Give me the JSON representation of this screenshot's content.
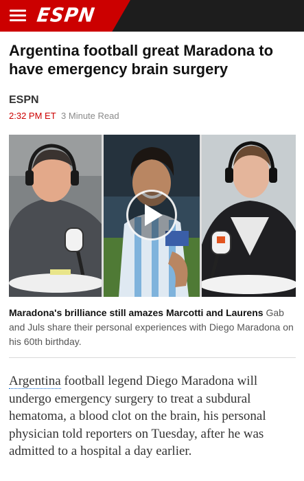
{
  "header": {
    "logo_text": "ESPN",
    "brand_color": "#cc0000",
    "bar_color": "#1d1d1d"
  },
  "article": {
    "headline": "Argentina football great Maradona to have emergency brain surgery",
    "source": "ESPN",
    "time": "2:32 PM ET",
    "read_time": "3 Minute Read"
  },
  "video": {
    "caption_title": "Maradona's brilliance still amazes Marcotti and Laurens",
    "caption_text": "Gab and Juls share their personal experiences with Diego Maradona on his 60th birthday."
  },
  "body": {
    "link_text": "Argentina",
    "rest_text": " football legend Diego Maradona will undergo emergency surgery to treat a subdural hematoma, a blood clot on the brain, his personal physician told reporters on Tuesday, after he was admitted to a hospital a day earlier."
  },
  "icons": {
    "menu": "hamburger-menu-icon",
    "play": "play-icon"
  }
}
